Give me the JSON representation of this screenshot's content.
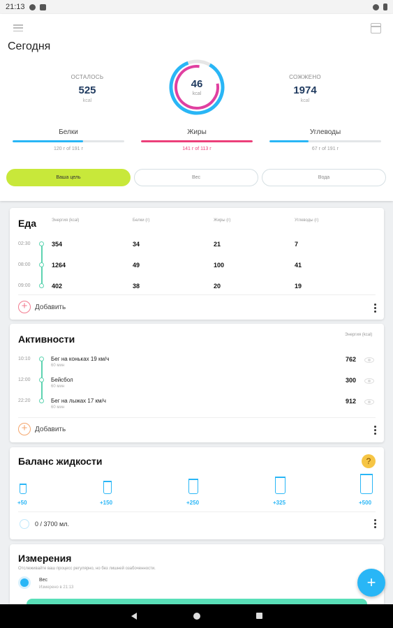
{
  "status": {
    "time": "21:13"
  },
  "header": {
    "title": "Сегодня",
    "remaining": {
      "label": "ОСТАЛОСЬ",
      "value": "525",
      "unit": "kcal"
    },
    "eaten": {
      "value": "46",
      "unit": "kcal"
    },
    "burned": {
      "label": "СОЖЖЕНО",
      "value": "1974",
      "unit": "kcal"
    },
    "macros": [
      {
        "name": "Белки",
        "amount": "120 г of 191 г",
        "progress": 0.63,
        "color": "#29b6f6"
      },
      {
        "name": "Жиры",
        "amount": "141 г of 113 г",
        "progress": 1.0,
        "color": "#ec407a"
      },
      {
        "name": "Углеводы",
        "amount": "67 г of 191 г",
        "progress": 0.35,
        "color": "#29b6f6"
      }
    ],
    "tabs": [
      "Ваша цель",
      "Вес",
      "Вода"
    ]
  },
  "food": {
    "title": "Еда",
    "columns": [
      "Энергия (kcal)",
      "Белки (г)",
      "Жиры (г)",
      "Углеводы (г)"
    ],
    "rows": [
      {
        "time": "02:30",
        "energy": "354",
        "protein": "34",
        "fat": "21",
        "carbs": "7"
      },
      {
        "time": "08:00",
        "energy": "1264",
        "protein": "49",
        "fat": "100",
        "carbs": "41"
      },
      {
        "time": "09:00",
        "energy": "402",
        "protein": "38",
        "fat": "20",
        "carbs": "19"
      }
    ],
    "add_label": "Добавить"
  },
  "activities": {
    "title": "Активности",
    "column": "Энергия (kcal)",
    "rows": [
      {
        "time": "10:10",
        "name": "Бег на коньках 19 км/ч",
        "duration": "60 мин",
        "energy": "762"
      },
      {
        "time": "12:00",
        "name": "Бейсбол",
        "duration": "60 мин",
        "energy": "300"
      },
      {
        "time": "22:20",
        "name": "Бег на лыжах 17 км/ч",
        "duration": "60 мин",
        "energy": "912"
      }
    ],
    "add_label": "Добавить"
  },
  "fluid": {
    "title": "Баланс жидкости",
    "portions": [
      "+50",
      "+150",
      "+250",
      "+325",
      "+500"
    ],
    "progress_text": "0 / 3700 мл."
  },
  "measurements": {
    "title": "Измерения",
    "description": "Отслеживайте ваш процесс регулярно, но без лишней озабоченности.",
    "item_name": "Вес",
    "item_sub": "Измерено в 21:13"
  }
}
